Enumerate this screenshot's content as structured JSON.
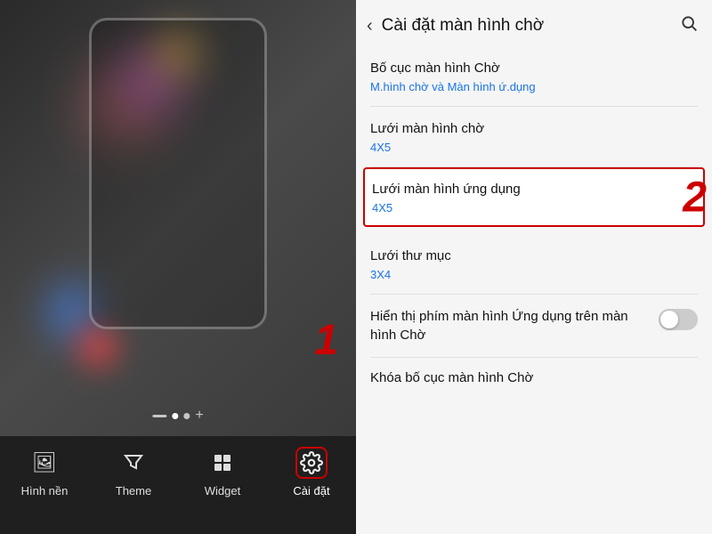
{
  "left": {
    "toolbar": {
      "items": [
        {
          "id": "wallpaper",
          "label": "Hình nền",
          "icon": "🖼"
        },
        {
          "id": "theme",
          "label": "Theme",
          "icon": "🎨"
        },
        {
          "id": "widget",
          "label": "Widget",
          "icon": "⊞"
        },
        {
          "id": "settings",
          "label": "Cài đặt",
          "icon": "⚙",
          "active": true
        }
      ]
    },
    "badge": "1"
  },
  "right": {
    "header": {
      "back_label": "‹",
      "title": "Cài đặt màn hình chờ",
      "search_icon": "🔍"
    },
    "items": [
      {
        "id": "layout",
        "title": "Bố cục màn hình Chờ",
        "subtitle": "M.hình chờ và Màn hình ứ.dụng",
        "highlighted": false
      },
      {
        "id": "grid-home",
        "title": "Lưới màn hình chờ",
        "subtitle": "4X5",
        "highlighted": false
      },
      {
        "id": "grid-app",
        "title": "Lưới màn hình ứng dụng",
        "subtitle": "4X5",
        "highlighted": true
      },
      {
        "id": "grid-folder",
        "title": "Lưới thư mục",
        "subtitle": "3X4",
        "highlighted": false
      }
    ],
    "toggle_item": {
      "title": "Hiển thị phím màn hình Ứng dụng trên màn hình Chờ"
    },
    "last_item": {
      "title": "Khóa bố cục màn hình Chờ"
    },
    "badge": "2"
  }
}
